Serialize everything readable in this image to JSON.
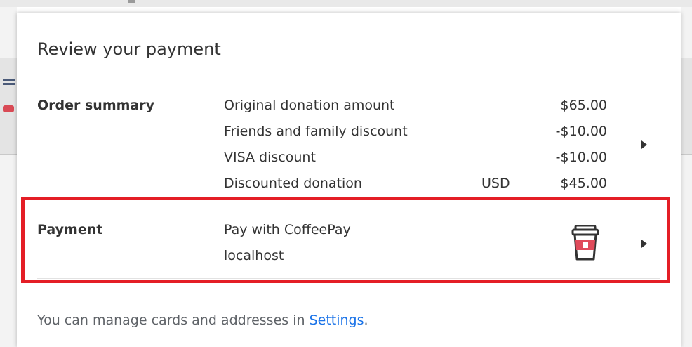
{
  "dialog": {
    "title": "Review your payment"
  },
  "order_summary": {
    "label": "Order summary",
    "rows": [
      {
        "label": "Original donation amount",
        "currency": "",
        "amount": "$65.00"
      },
      {
        "label": "Friends and family discount",
        "currency": "",
        "amount": "-$10.00"
      },
      {
        "label": "VISA discount",
        "currency": "",
        "amount": "-$10.00"
      },
      {
        "label": "Discounted donation",
        "currency": "USD",
        "amount": "$45.00"
      }
    ],
    "expand_icon": "chevron-right-icon"
  },
  "payment": {
    "label": "Payment",
    "method": "Pay with CoffeePay",
    "origin": "localhost",
    "app_icon": "coffee-cup-icon",
    "expand_icon": "chevron-right-icon"
  },
  "footer": {
    "text": "You can manage cards and addresses in ",
    "link_label": "Settings",
    "suffix": "."
  },
  "colors": {
    "highlight": "#e41e26",
    "link": "#1a73e8",
    "text": "#333333",
    "muted": "#5f6368"
  }
}
